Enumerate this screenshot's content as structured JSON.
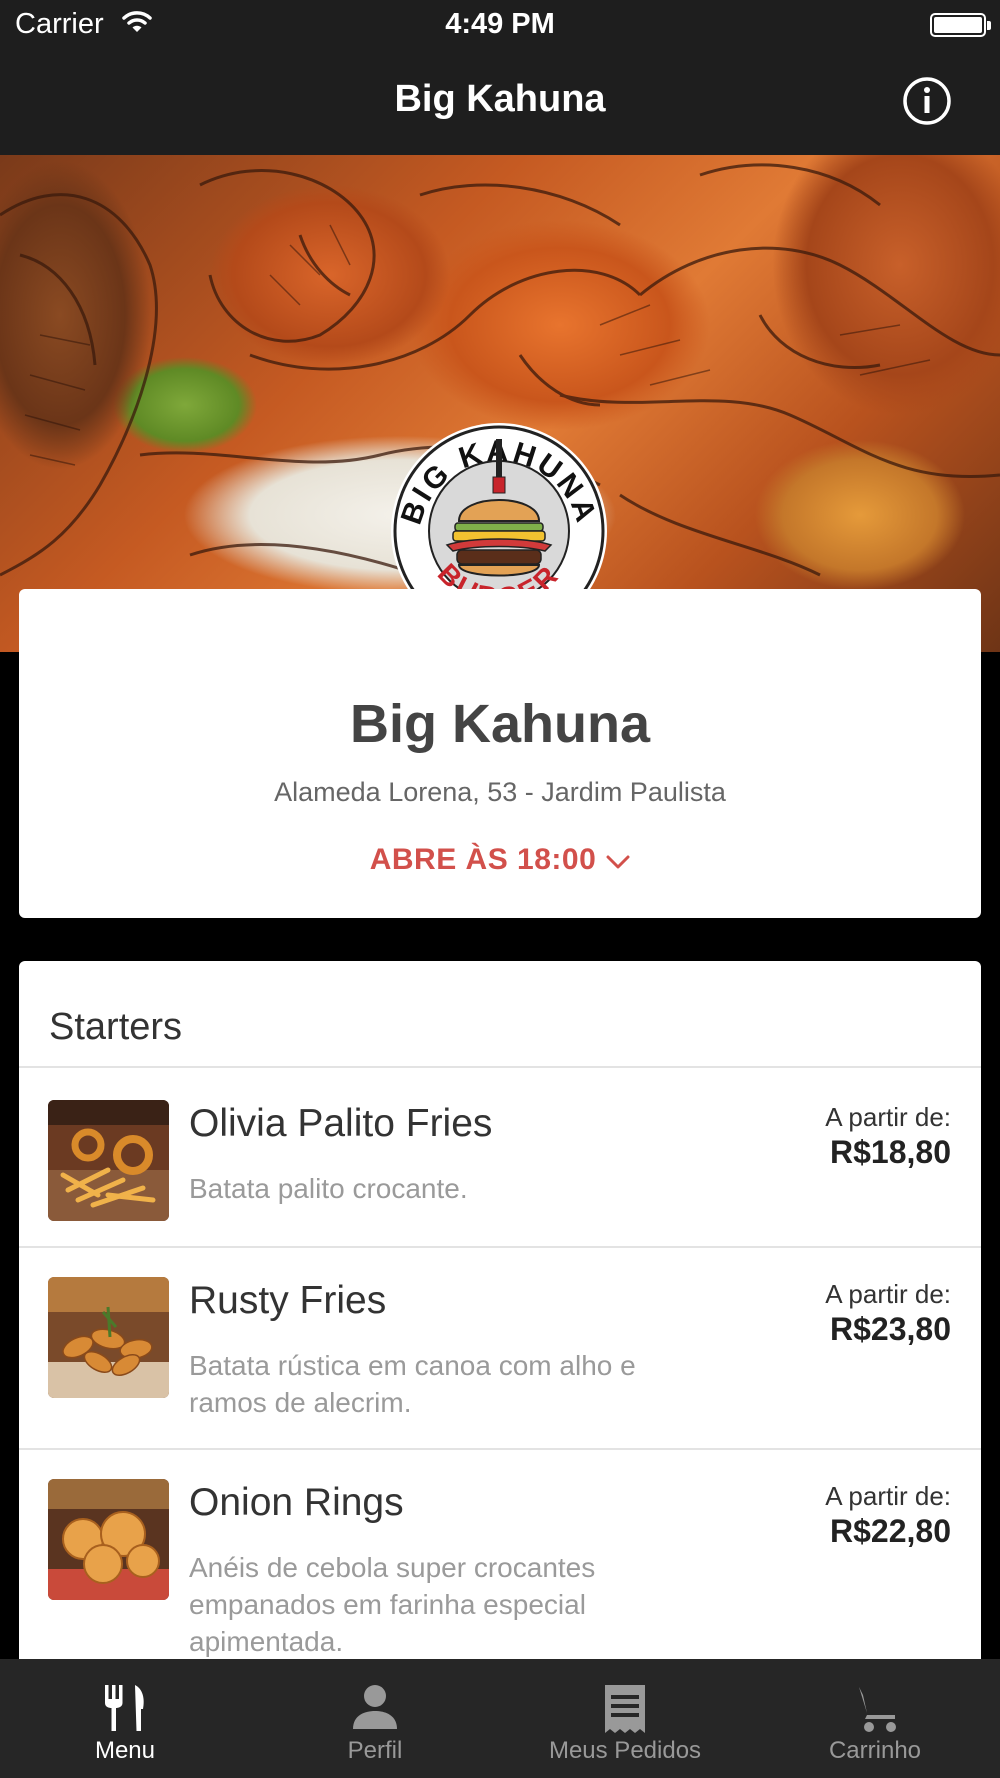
{
  "status_bar": {
    "carrier": "Carrier",
    "time": "4:49 PM",
    "battery_level": 1.0
  },
  "nav": {
    "title": "Big Kahuna",
    "info_icon": "info-icon"
  },
  "logo": {
    "text_top": "BIG KAHUNA",
    "text_bottom": "BURGER"
  },
  "restaurant": {
    "name": "Big Kahuna",
    "address": "Alameda Lorena, 53 - Jardim Paulista",
    "hours": "ABRE ÀS 18:00",
    "hours_color": "#d2504b"
  },
  "menu": {
    "section_title": "Starters",
    "items": [
      {
        "name": "Olivia Palito Fries",
        "description": "Batata palito crocante.",
        "from_label": "A partir de:",
        "price": "R$18,80"
      },
      {
        "name": "Rusty Fries",
        "description": "Batata rústica em canoa com alho e ramos de alecrim.",
        "from_label": "A partir de:",
        "price": "R$23,80"
      },
      {
        "name": "Onion Rings",
        "description": "Anéis de cebola super crocantes empanados em farinha especial apimentada.",
        "from_label": "A partir de:",
        "price": "R$22,80"
      }
    ]
  },
  "tabs": [
    {
      "label": "Menu",
      "icon": "fork-knife-icon",
      "active": true
    },
    {
      "label": "Perfil",
      "icon": "person-icon",
      "active": false
    },
    {
      "label": "Meus Pedidos",
      "icon": "receipt-icon",
      "active": false
    },
    {
      "label": "Carrinho",
      "icon": "cart-icon",
      "active": false
    }
  ],
  "colors": {
    "bar_background": "#1e1e1e",
    "tab_bar_background": "#262626",
    "accent": "#d2504b"
  }
}
